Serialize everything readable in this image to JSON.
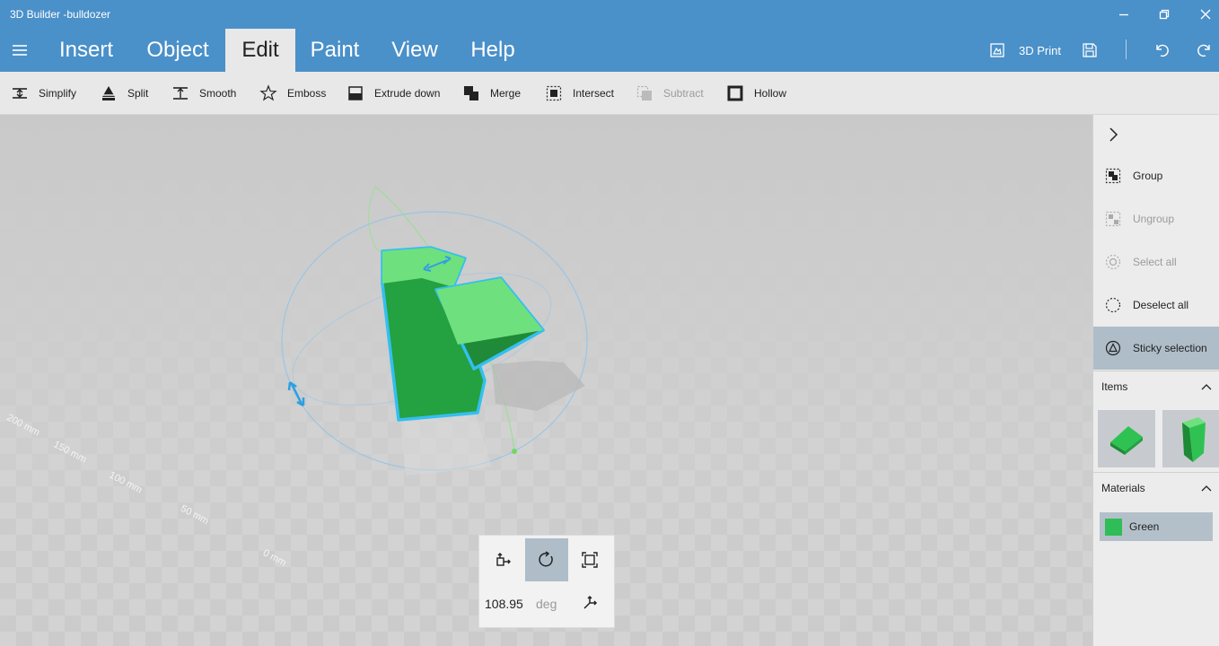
{
  "window": {
    "title": "3D Builder -bulldozer"
  },
  "menu": {
    "tabs": [
      {
        "label": "Insert"
      },
      {
        "label": "Object"
      },
      {
        "label": "Edit",
        "active": true
      },
      {
        "label": "Paint"
      },
      {
        "label": "View"
      },
      {
        "label": "Help"
      }
    ],
    "print_label": "3D Print"
  },
  "ribbon": {
    "tools": [
      {
        "label": "Simplify",
        "icon": "simplify-icon"
      },
      {
        "label": "Split",
        "icon": "split-icon"
      },
      {
        "label": "Smooth",
        "icon": "smooth-icon"
      },
      {
        "label": "Emboss",
        "icon": "star-icon"
      },
      {
        "label": "Extrude down",
        "icon": "extrude-down-icon"
      },
      {
        "label": "Merge",
        "icon": "merge-icon"
      },
      {
        "label": "Intersect",
        "icon": "intersect-icon"
      },
      {
        "label": "Subtract",
        "icon": "subtract-icon",
        "disabled": true
      },
      {
        "label": "Hollow",
        "icon": "hollow-icon"
      }
    ]
  },
  "viewport": {
    "ruler_labels": [
      "200 mm",
      "150 mm",
      "100 mm",
      "50 mm",
      "0 mm"
    ],
    "transform": {
      "value": "108.95",
      "unit": "deg",
      "active_mode": "rotate"
    }
  },
  "panel": {
    "actions": [
      {
        "label": "Group",
        "icon": "group-icon"
      },
      {
        "label": "Ungroup",
        "icon": "ungroup-icon",
        "disabled": true
      },
      {
        "label": "Select all",
        "icon": "select-all-icon",
        "disabled": true
      },
      {
        "label": "Deselect all",
        "icon": "deselect-all-icon"
      },
      {
        "label": "Sticky selection",
        "icon": "sticky-selection-icon",
        "active": true
      }
    ],
    "items_header": "Items",
    "materials_header": "Materials",
    "materials": [
      {
        "label": "Green",
        "color": "#2ebd57"
      }
    ]
  },
  "colors": {
    "accent": "#4a90c9",
    "object_light": "#6fe07e",
    "object_dark": "#24a140",
    "selection_outline": "#33bff0",
    "active_bg": "#aebdc8"
  }
}
